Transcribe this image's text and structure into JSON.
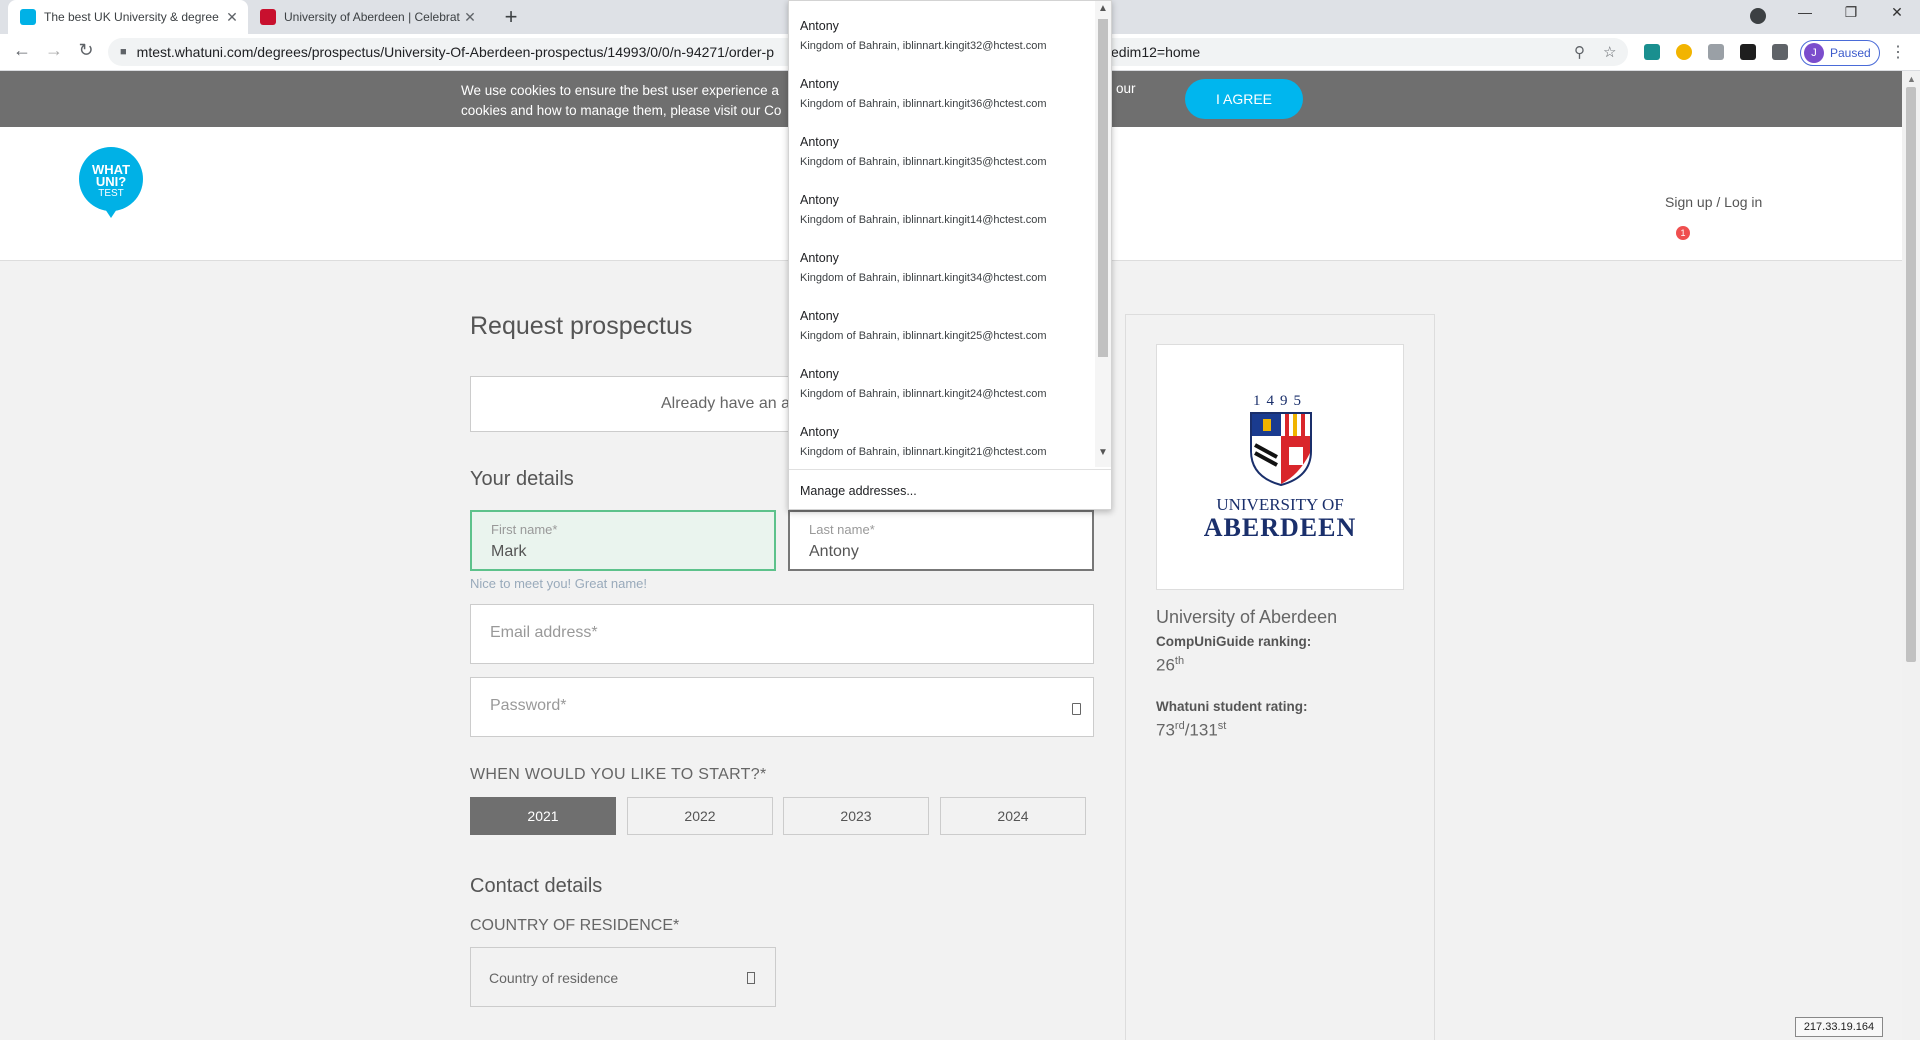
{
  "browser": {
    "tabs": [
      {
        "title": "The best UK University & degree",
        "active": true
      },
      {
        "title": "University of Aberdeen | Celebrat",
        "active": false
      }
    ],
    "new_tab": "+",
    "url_left": "mtest.whatuni.com/degrees/prospectus/University-Of-Aberdeen-prospectus/14993/0/0/n-94271/order-p",
    "url_right": "edim12=home",
    "profile_initial": "J",
    "profile_status": "Paused",
    "win_min": "—",
    "win_restore": "❐",
    "win_close": "✕"
  },
  "cookie_banner": {
    "text": "We use cookies to ensure the best user experience a cookies and how to manage them, please visit our Co",
    "text_tail": "our",
    "agree_label": "I AGREE"
  },
  "header": {
    "logo_line1": "WHAT",
    "logo_line2": "UNI?",
    "logo_line3": "TEST",
    "signin": "Sign up / Log in",
    "notif_count": "1"
  },
  "form": {
    "title": "Request prospectus",
    "already": "Already have an a",
    "your_details": "Your details",
    "first_name": {
      "label": "First name*",
      "value": "Mark"
    },
    "last_name": {
      "label": "Last name*",
      "value": "Antony"
    },
    "hint": "Nice to meet you! Great name!",
    "email_placeholder": "Email address*",
    "password_placeholder": "Password*",
    "start_question": "WHEN WOULD YOU LIKE TO START?*",
    "years": [
      "2021",
      "2022",
      "2023",
      "2024"
    ],
    "selected_year": "2021",
    "contact_details": "Contact details",
    "country_label": "COUNTRY OF RESIDENCE*",
    "country_placeholder": "Country of residence"
  },
  "university": {
    "logo_year": "1495",
    "logo_line1": "UNIVERSITY OF",
    "logo_line2": "ABERDEEN",
    "name": "University of Aberdeen",
    "ranking_label": "CompUniGuide ranking:",
    "ranking_value": "26",
    "ranking_suffix": "th",
    "rating_label": "Whatuni student rating:",
    "rating_value": "73",
    "rating_suffix": "rd",
    "rating_total": "/131",
    "rating_total_suffix": "st"
  },
  "autofill": {
    "items": [
      {
        "name": "Antony",
        "detail": "Kingdom of Bahrain, iblinnart.kingit32@hctest.com"
      },
      {
        "name": "Antony",
        "detail": "Kingdom of Bahrain, iblinnart.kingit36@hctest.com"
      },
      {
        "name": "Antony",
        "detail": "Kingdom of Bahrain, iblinnart.kingit35@hctest.com"
      },
      {
        "name": "Antony",
        "detail": "Kingdom of Bahrain, iblinnart.kingit14@hctest.com"
      },
      {
        "name": "Antony",
        "detail": "Kingdom of Bahrain, iblinnart.kingit34@hctest.com"
      },
      {
        "name": "Antony",
        "detail": "Kingdom of Bahrain, iblinnart.kingit25@hctest.com"
      },
      {
        "name": "Antony",
        "detail": "Kingdom of Bahrain, iblinnart.kingit24@hctest.com"
      },
      {
        "name": "Antony",
        "detail": "Kingdom of Bahrain, iblinnart.kingit21@hctest.com"
      }
    ],
    "manage": "Manage addresses..."
  },
  "ip_badge": "217.33.19.164"
}
